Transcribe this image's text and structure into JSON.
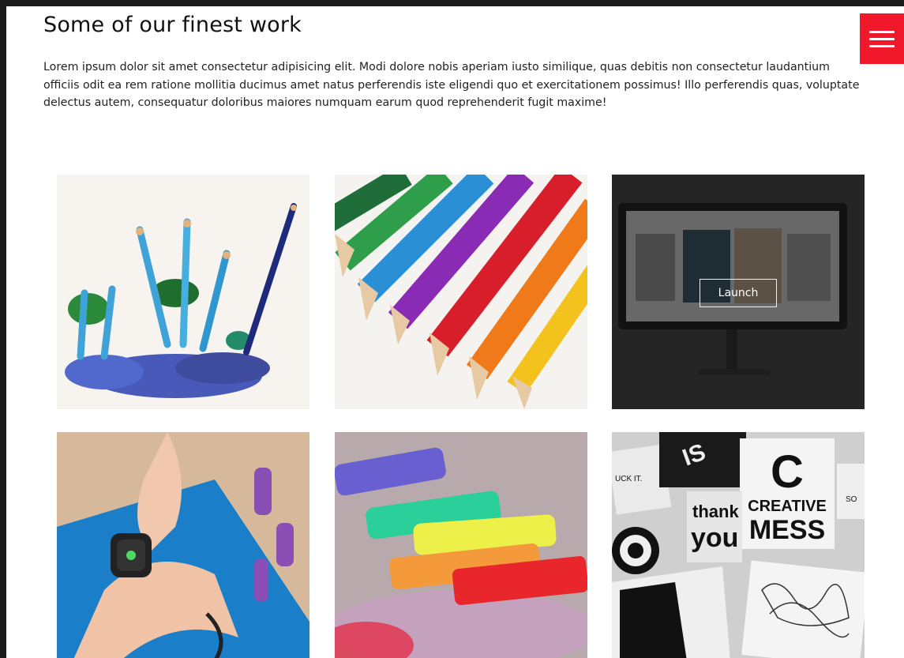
{
  "header": {
    "title": "Some of our finest work",
    "intro": "Lorem ipsum dolor sit amet consectetur adipisicing elit. Modi dolore nobis aperiam iusto similique, quas debitis non consectetur laudantium officiis odit ea rem ratione mollitia ducimus amet natus perferendis iste eligendi quo et exercitationem possimus! Illo perferendis quas, voluptate delectus autem, consequatur doloribus maiores numquam earum quod reprehenderit fugit maxime!"
  },
  "menu": {
    "icon": "hamburger-menu-icon",
    "color": "#f2182c"
  },
  "portfolio": {
    "launch_label": "Launch",
    "tiles": [
      {
        "name": "blue-pencil-shavings-image"
      },
      {
        "name": "colored-pencils-image"
      },
      {
        "name": "gallery-monitor-image"
      },
      {
        "name": "smartwatch-wrist-image"
      },
      {
        "name": "pastel-chalks-image"
      },
      {
        "name": "creative-mess-posters-image"
      }
    ],
    "poster_text": {
      "big_letter": "C",
      "creative": "CREATIVE",
      "mess": "MESS",
      "thank": "thank",
      "you": "you",
      "uck": "UCK IT.",
      "so": "SO",
      "is": "IS"
    }
  }
}
